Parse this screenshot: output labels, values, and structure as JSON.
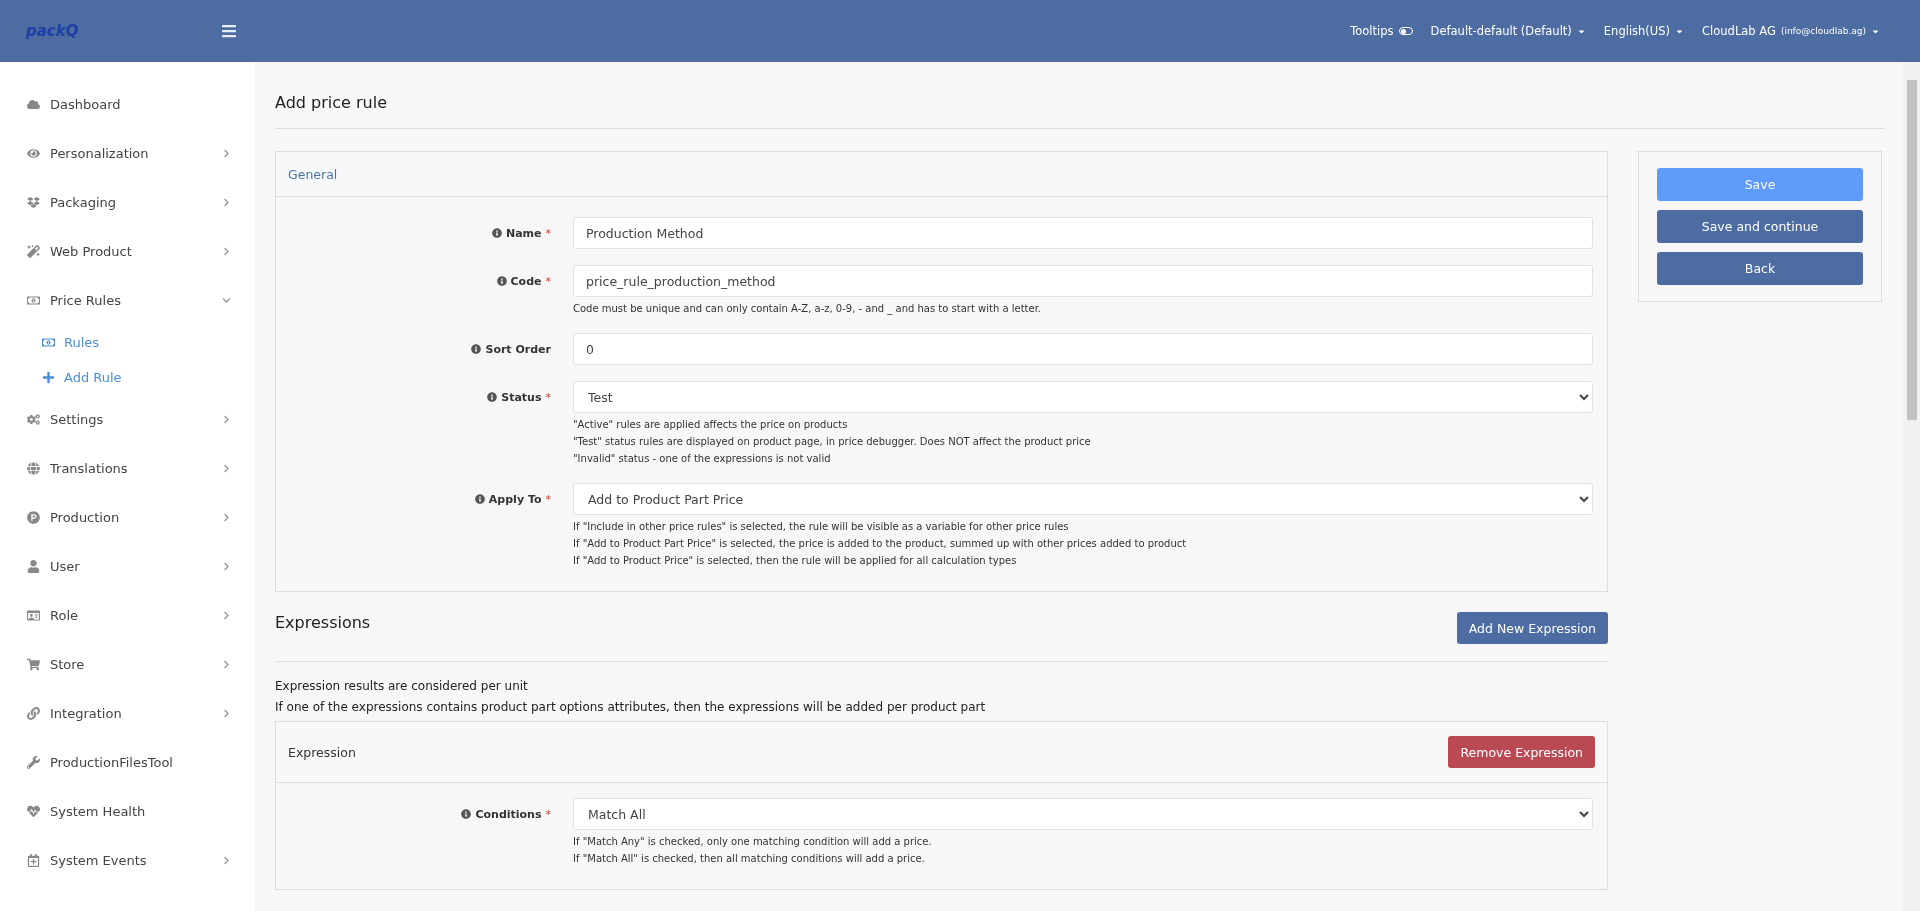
{
  "header": {
    "logo": "packQ",
    "tooltips": {
      "label": "Tooltips",
      "on": false
    },
    "menus": [
      "Default-default (Default)",
      "English(US)"
    ],
    "account": {
      "name": "CloudLab AG",
      "email": "(info@cloudlab.ag)"
    }
  },
  "sidebar": {
    "items": [
      {
        "label": "Dashboard",
        "has_submenu": false
      },
      {
        "label": "Personalization",
        "has_submenu": true,
        "expanded": false
      },
      {
        "label": "Packaging",
        "has_submenu": true,
        "expanded": false
      },
      {
        "label": "Web Product",
        "has_submenu": true,
        "expanded": false
      },
      {
        "label": "Price Rules",
        "has_submenu": true,
        "expanded": true,
        "children": [
          {
            "label": "Rules"
          },
          {
            "label": "Add Rule"
          }
        ]
      },
      {
        "label": "Settings",
        "has_submenu": true,
        "expanded": false
      },
      {
        "label": "Translations",
        "has_submenu": true,
        "expanded": false
      },
      {
        "label": "Production",
        "has_submenu": true,
        "expanded": false
      },
      {
        "label": "User",
        "has_submenu": true,
        "expanded": false
      },
      {
        "label": "Role",
        "has_submenu": true,
        "expanded": false
      },
      {
        "label": "Store",
        "has_submenu": true,
        "expanded": false
      },
      {
        "label": "Integration",
        "has_submenu": true,
        "expanded": false
      },
      {
        "label": "ProductionFilesTool",
        "has_submenu": false
      },
      {
        "label": "System Health",
        "has_submenu": false
      },
      {
        "label": "System Events",
        "has_submenu": true,
        "expanded": false
      }
    ]
  },
  "page": {
    "title": "Add price rule",
    "required_marker": "*"
  },
  "general": {
    "title": "General",
    "fields": [
      {
        "label": "Name",
        "required": true,
        "kind": "input",
        "value": "Production Method"
      },
      {
        "label": "Code",
        "required": true,
        "kind": "input",
        "value": "price_rule_production_method",
        "help": [
          "Code must be unique and can only contain A-Z, a-z, 0-9, - and _ and has to start with a letter."
        ]
      },
      {
        "label": "Sort Order",
        "required": false,
        "kind": "input",
        "value": "0"
      },
      {
        "label": "Status",
        "required": true,
        "kind": "select",
        "value": "Test",
        "help": [
          "\"Active\" rules are applied affects the price on products",
          "\"Test\" status rules are displayed on product page, in price debugger. Does NOT affect the product price",
          "\"Invalid\" status - one of the expressions is not valid"
        ]
      },
      {
        "label": "Apply To",
        "required": true,
        "kind": "select",
        "value": "Add to Product Part Price",
        "help": [
          "If \"Include in other price rules\" is selected, the rule will be visible as a variable for other price rules",
          "If \"Add to Product Part Price\" is selected, the price is added to the product, summed up with other prices added to product",
          "If \"Add to Product Price\" is selected, then the rule will be applied for all calculation types"
        ]
      }
    ]
  },
  "actions": [
    "Save",
    "Save and continue",
    "Back"
  ],
  "expressions": {
    "title": "Expressions",
    "add_button": "Add New Expression",
    "notes": [
      "Expression results are considered per unit",
      "If one of the expressions contains product part options attributes, then the expressions will be added per product part"
    ],
    "expression": {
      "title": "Expression",
      "remove_button": "Remove Expression",
      "fields": [
        {
          "label": "Conditions",
          "required": true,
          "kind": "select",
          "value": "Match All",
          "help": [
            "If \"Match Any\" is checked, only one matching condition will add a price.",
            "If \"Match All\" is checked, then all matching conditions will add a price."
          ]
        }
      ]
    }
  }
}
